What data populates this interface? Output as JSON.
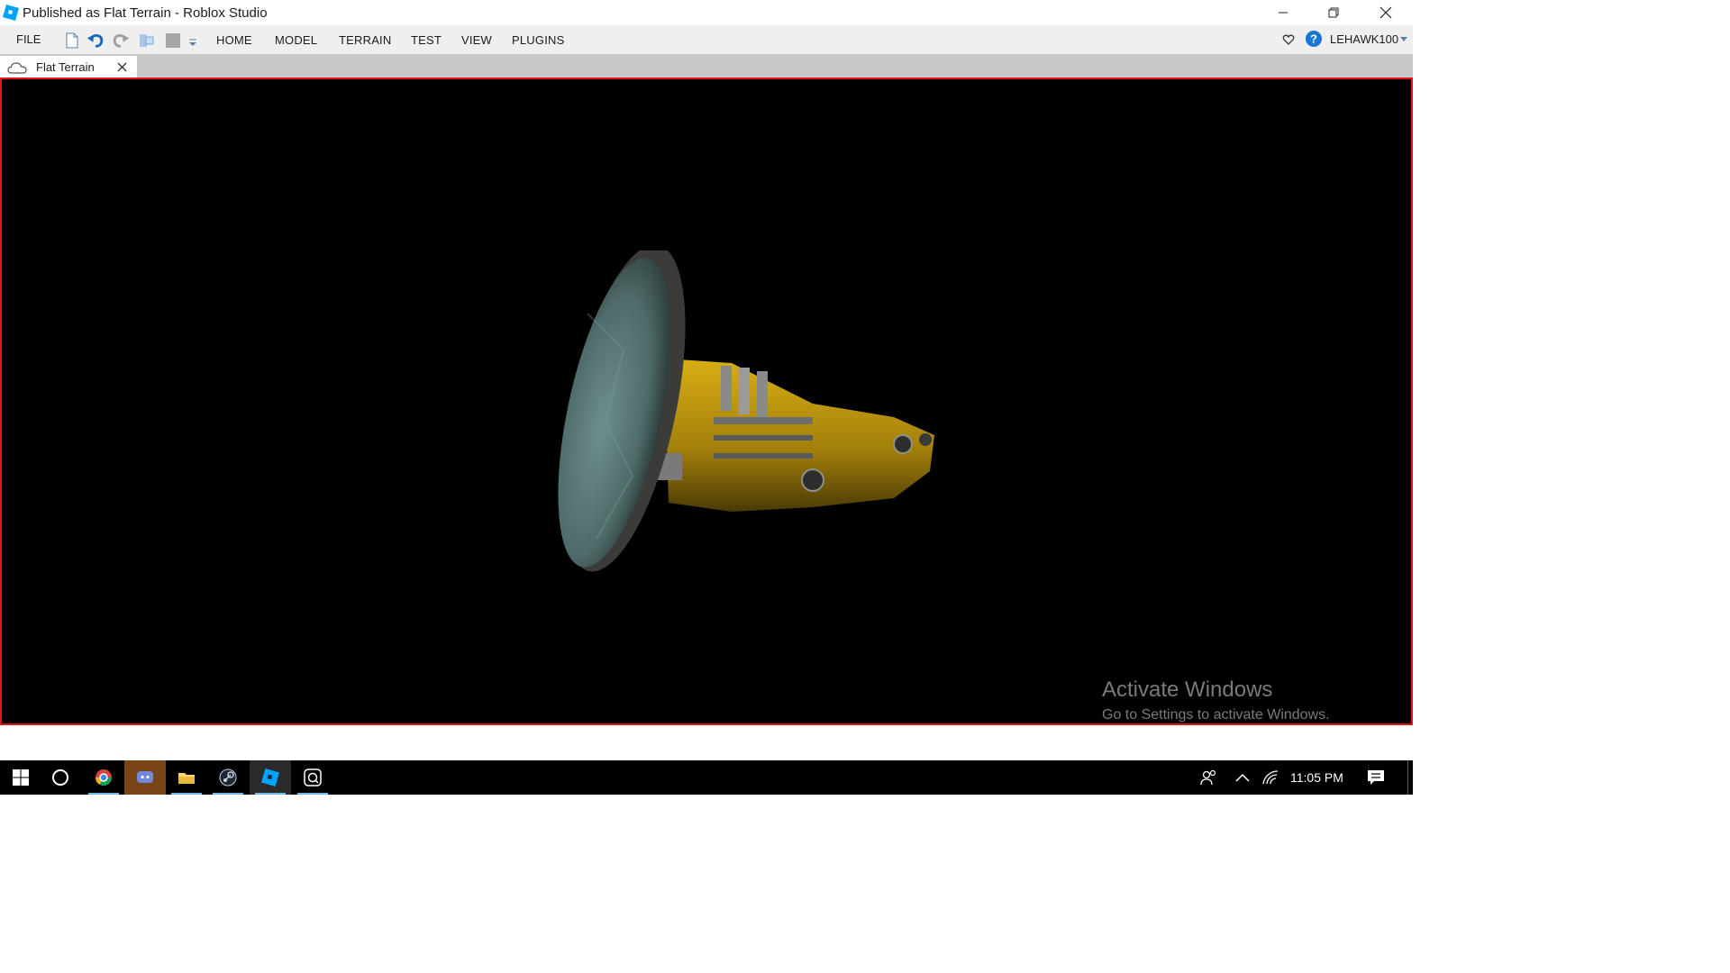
{
  "window": {
    "title": "Published as Flat Terrain - Roblox Studio",
    "controls": [
      "minimize-icon",
      "restore-icon",
      "close-icon"
    ]
  },
  "menubar": {
    "file_label": "FILE",
    "quick_access": [
      "new-file-icon",
      "undo-icon",
      "redo-icon",
      "group-icon",
      "stop-icon",
      "customize-dropdown-icon"
    ],
    "tabs": [
      {
        "label": "HOME"
      },
      {
        "label": "MODEL"
      },
      {
        "label": "TERRAIN"
      },
      {
        "label": "TEST"
      },
      {
        "label": "VIEW"
      },
      {
        "label": "PLUGINS"
      }
    ],
    "username": "LEHAWK100"
  },
  "document_tabs": [
    {
      "label": "Flat Terrain",
      "icon": "cloud-icon",
      "active": true
    }
  ],
  "viewport": {
    "watermark_title": "Activate Windows",
    "watermark_subtitle": "Go to Settings to activate Windows.",
    "border_color": "#e8121a"
  },
  "taskbar": {
    "apps": [
      "windows-start-icon",
      "cortana-icon",
      "chrome-icon",
      "discord-icon",
      "file-explorer-icon",
      "steam-icon",
      "roblox-studio-icon",
      "app-icon"
    ],
    "time": "11:05 PM"
  },
  "colors": {
    "accent": "#00a2ff",
    "viewport_bg": "#000000",
    "ship_yellow": "#c9a10e",
    "shield_teal": "#5f7f7d"
  }
}
